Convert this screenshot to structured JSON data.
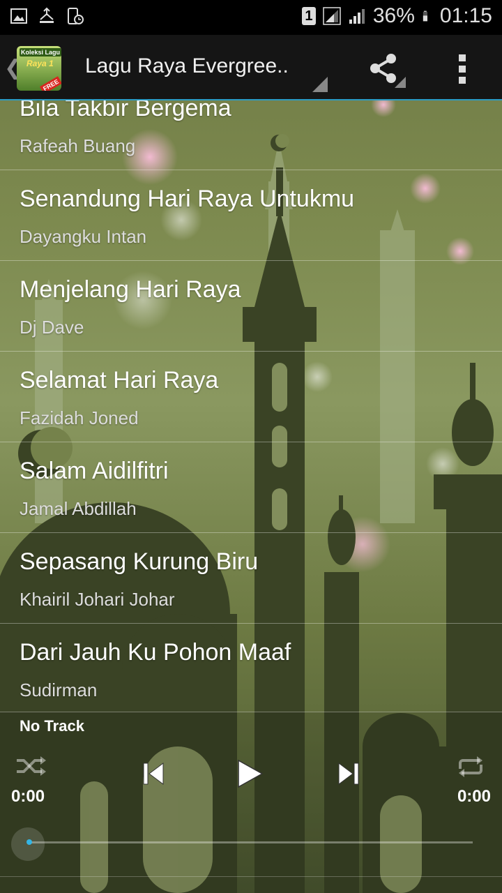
{
  "status_bar": {
    "sim_badge": "1",
    "battery_percent": "36%",
    "time": "01:15"
  },
  "app_bar": {
    "title": "Lagu Raya Evergree..",
    "icon": {
      "line1": "Koleksi Lagu",
      "line2": "Raya 1",
      "badge": "FREE"
    }
  },
  "songs": [
    {
      "title": "Bila Takbir Bergema",
      "artist": "Rafeah Buang"
    },
    {
      "title": "Senandung Hari Raya Untukmu",
      "artist": "Dayangku Intan"
    },
    {
      "title": "Menjelang Hari Raya",
      "artist": "Dj Dave"
    },
    {
      "title": "Selamat Hari Raya",
      "artist": "Fazidah Joned"
    },
    {
      "title": "Salam Aidilfitri",
      "artist": "Jamal Abdillah"
    },
    {
      "title": "Sepasang Kurung Biru",
      "artist": "Khairil Johari Johar"
    },
    {
      "title": "Dari Jauh Ku Pohon Maaf",
      "artist": "Sudirman"
    }
  ],
  "player": {
    "track_name": "No Track",
    "elapsed": "0:00",
    "duration": "0:00",
    "progress": 0,
    "icons": [
      "shuffle-icon",
      "previous-icon",
      "play-icon",
      "next-icon",
      "repeat-icon"
    ]
  },
  "colors": {
    "accent": "#33b5e5",
    "action_bar": "#151515"
  }
}
